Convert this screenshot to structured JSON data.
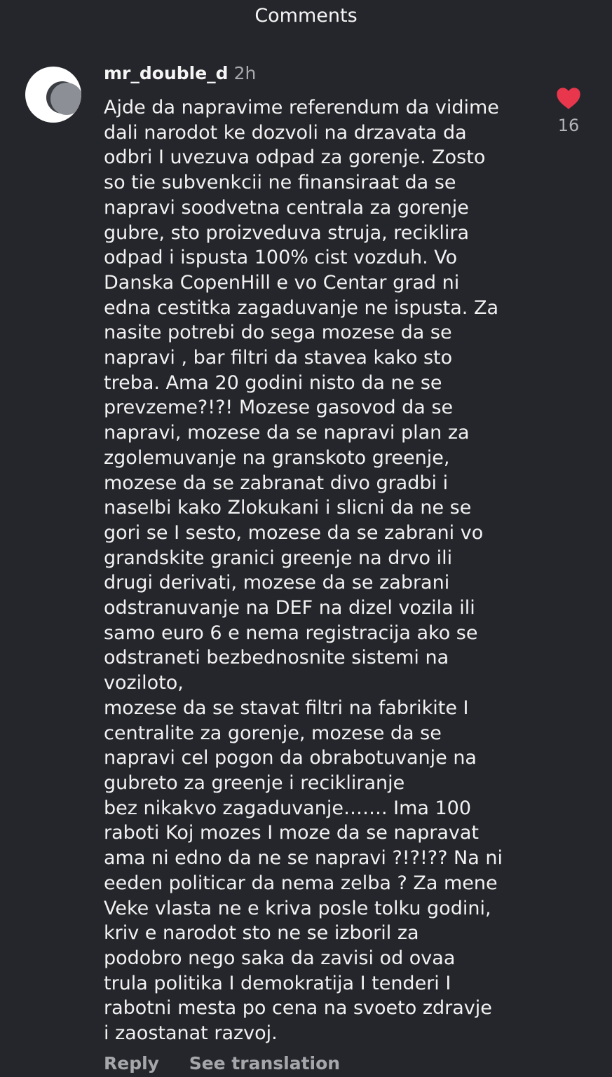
{
  "header": {
    "title": "Comments"
  },
  "comment": {
    "username": "mr_double_d",
    "time": "2h",
    "text": "Ajde da napravime referendum da vidime\ndali narodot ke dozvoli na drzavata da\nodbri I uvezuva odpad za gorenje. Zosto\nso tie subvenkcii ne finansiraat da se\nnapravi soodvetna centrala za gorenje\ngubre, sto proizveduva struja, reciklira\nodpad i ispusta 100% cist vozduh. Vo\nDanska CopenHill e vo Centar grad ni\nedna cestitka zagaduvanje ne ispusta. Za\nnasite potrebi do sega mozese da se\nnapravi , bar filtri da stavea kako sto\ntreba. Ama 20 godini nisto da ne se\nprevzeme?!?! Mozese gasovod da se\nnapravi, mozese da se napravi plan za\nzgolemuvanje na granskoto greenje,\nmozese da se zabranat divo gradbi i\nnaselbi kako Zlokukani i slicni da ne se\ngori se I sesto, mozese da se zabrani vo\ngrandskite granici greenje na drvo ili\ndrugi derivati, mozese da se zabrani\nodstranuvanje na DEF na dizel vozila ili\nsamo euro 6 e nema registracija ako se\nodstraneti bezbednosnite sistemi na\nvoziloto,\nmozese da se stavat filtri na fabrikite I\ncentralite za gorenje, mozese da se\nnapravi cel pogon da obrabotuvanje na\ngubreto za greenje i recikliranje\nbez nikakvo zagaduvanje……. Ima 100\nraboti Koj mozes I moze da se napravat\nama ni edno da ne se napravi ?!?!?? Na ni\needen politicar da nema zelba ? Za mene\nVeke vlasta ne e kriva posle tolku godini,\nkriv e narodot sto ne se izboril za\npodobro nego saka da zavisi od ovaa\ntrula politika I demokratija I tenderi I\nrabotni mesta po cena na svoeto zdravje\ni zaostanat razvoj.",
    "actions": {
      "reply": "Reply",
      "translate": "See translation"
    },
    "likes": "16"
  },
  "colors": {
    "background": "#25262b",
    "heart": "#e8374d",
    "muted_text": "#a6a7ab"
  },
  "icons": {
    "like": "heart-icon",
    "avatar": "avatar-icon"
  }
}
